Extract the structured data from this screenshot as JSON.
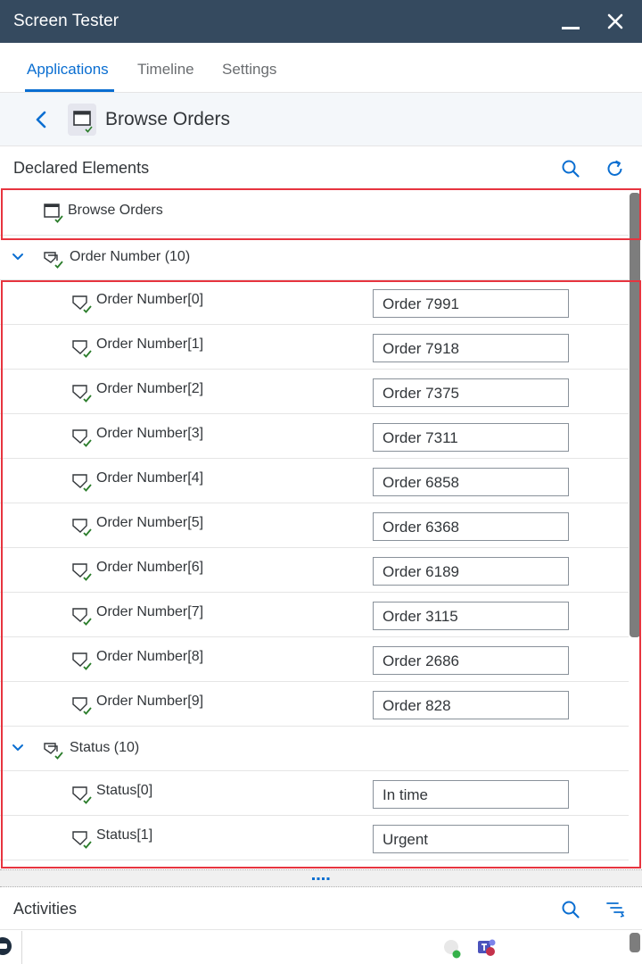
{
  "window": {
    "title": "Screen Tester"
  },
  "tabs": [
    {
      "label": "Applications",
      "active": true
    },
    {
      "label": "Timeline",
      "active": false
    },
    {
      "label": "Settings",
      "active": false
    }
  ],
  "page": {
    "title": "Browse Orders"
  },
  "declared": {
    "title": "Declared Elements",
    "page_item": "Browse Orders",
    "groups": [
      {
        "label": "Order Number (10)",
        "items": [
          {
            "label": "Order Number[0]",
            "value": "Order 7991"
          },
          {
            "label": "Order Number[1]",
            "value": "Order 7918"
          },
          {
            "label": "Order Number[2]",
            "value": "Order 7375"
          },
          {
            "label": "Order Number[3]",
            "value": "Order 7311"
          },
          {
            "label": "Order Number[4]",
            "value": "Order 6858"
          },
          {
            "label": "Order Number[5]",
            "value": "Order 6368"
          },
          {
            "label": "Order Number[6]",
            "value": "Order 6189"
          },
          {
            "label": "Order Number[7]",
            "value": "Order 3115"
          },
          {
            "label": "Order Number[8]",
            "value": "Order 2686"
          },
          {
            "label": "Order Number[9]",
            "value": "Order 828"
          }
        ]
      },
      {
        "label": "Status (10)",
        "items": [
          {
            "label": "Status[0]",
            "value": "In time"
          },
          {
            "label": "Status[1]",
            "value": "Urgent"
          }
        ]
      }
    ]
  },
  "activities": {
    "title": "Activities"
  },
  "colors": {
    "header": "#354a5f",
    "accent": "#0a6ed1",
    "highlight": "#e7343f",
    "check": "#2b7d2b"
  }
}
